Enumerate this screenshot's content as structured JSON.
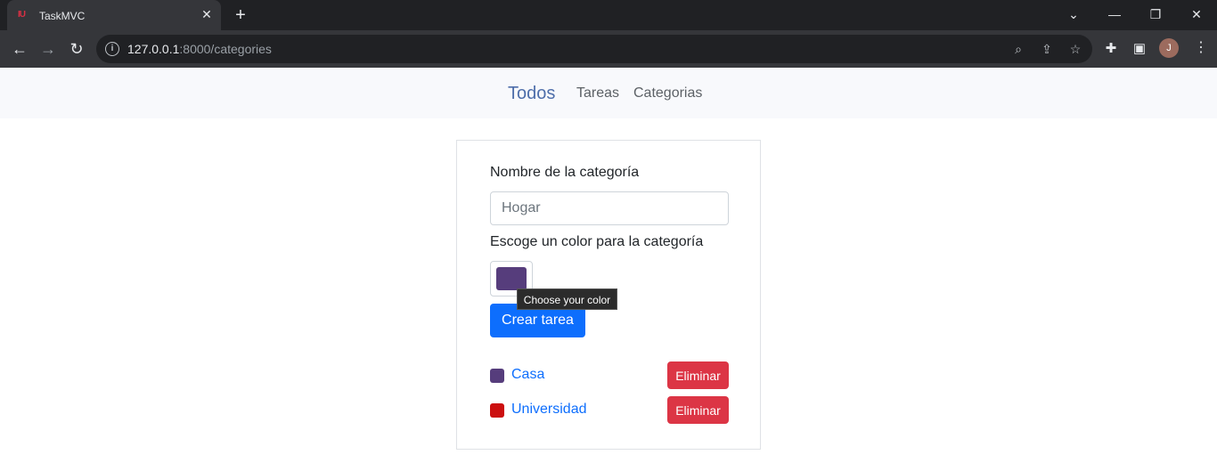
{
  "browser": {
    "tab_title": "TaskMVC",
    "tab_favicon": "IU",
    "url_host": "127.0.0.1",
    "url_rest": ":8000/categories",
    "profile_initial": "J"
  },
  "nav": {
    "brand": "Todos",
    "links": [
      "Tareas",
      "Categorias"
    ]
  },
  "form": {
    "name_label": "Nombre de la categoría",
    "name_placeholder": "Hogar",
    "color_label": "Escoge un color para la categoría",
    "color_value": "#563d7c",
    "color_tooltip": "Choose your color",
    "submit_label": "Crear tarea"
  },
  "categories": [
    {
      "name": "Casa",
      "color": "#563d7c",
      "delete_label": "Eliminar"
    },
    {
      "name": "Universidad",
      "color": "#cc0f0f",
      "delete_label": "Eliminar"
    }
  ]
}
